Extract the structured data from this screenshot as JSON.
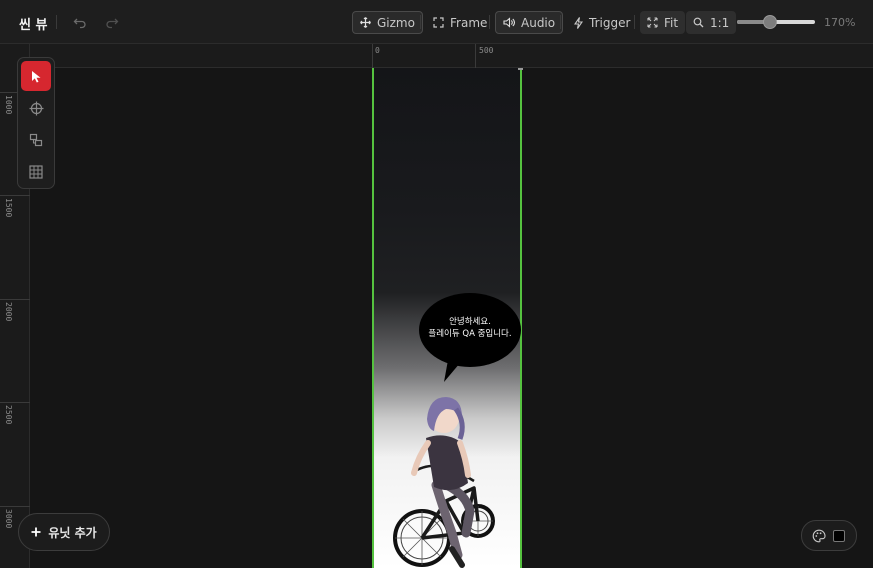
{
  "header": {
    "title": "씬 뷰",
    "undo_icon": "undo-icon",
    "redo_icon": "redo-icon",
    "gizmo_label": "Gizmo",
    "frame_label": "Frame",
    "audio_label": "Audio",
    "trigger_label": "Trigger",
    "fit_label": "Fit",
    "one_to_one_label": "1:1",
    "zoom_value": 170,
    "zoom_text": "170%"
  },
  "ruler": {
    "horizontal": [
      "0",
      "500"
    ],
    "vertical": [
      "1000",
      "1500",
      "2000",
      "2500",
      "3000"
    ]
  },
  "tools": [
    {
      "name": "select",
      "icon": "cursor-arrow-icon",
      "active": true
    },
    {
      "name": "move",
      "icon": "crosshair-icon",
      "active": false
    },
    {
      "name": "transform",
      "icon": "layers-icon",
      "active": false
    },
    {
      "name": "grid",
      "icon": "grid-icon",
      "active": false
    }
  ],
  "scene": {
    "bubble_line1": "안녕하세요.",
    "bubble_line2": "플레이듀 QA 중입니다.",
    "frame_color": "#55c23f"
  },
  "bottom": {
    "add_unit_label": "유닛 추가",
    "palette_icon": "palette-icon"
  },
  "colors": {
    "accent": "#d6272f",
    "frame": "#55c23f"
  }
}
